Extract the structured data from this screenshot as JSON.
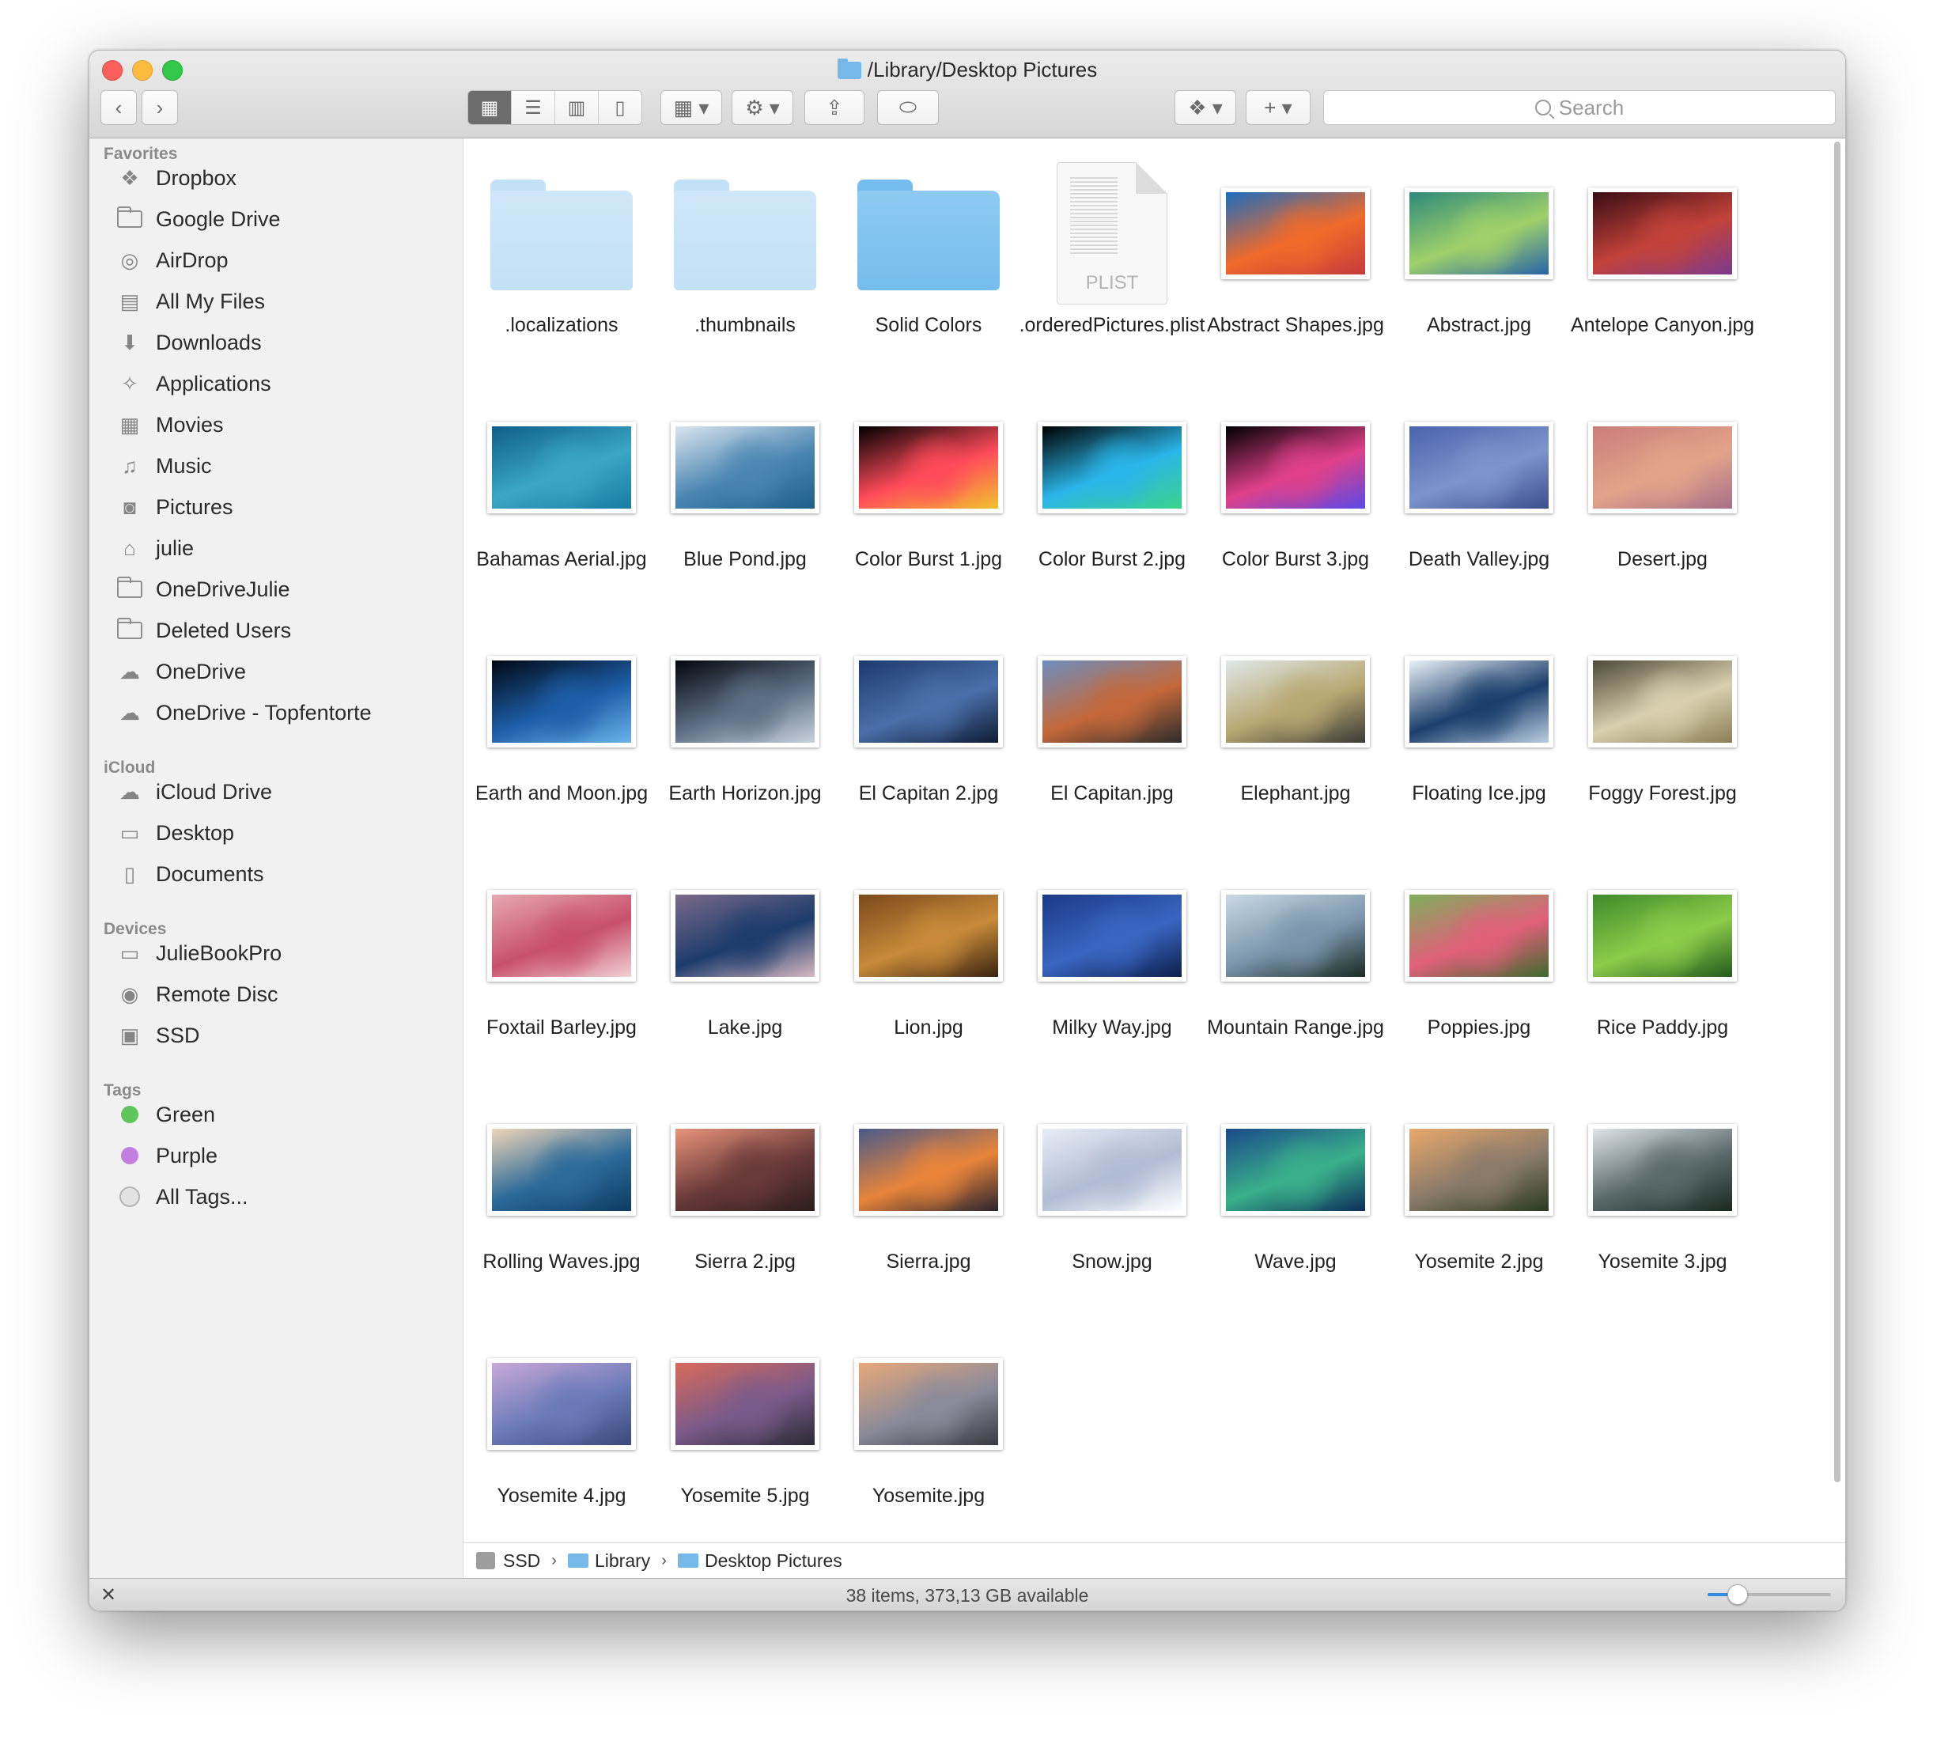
{
  "window": {
    "title": "/Library/Desktop Pictures"
  },
  "toolbar": {
    "back": "‹",
    "forward": "›",
    "search_placeholder": "Search",
    "view_modes": [
      "icon",
      "list",
      "column",
      "cover-flow"
    ],
    "selected_view": "icon"
  },
  "sidebar": {
    "favorites_label": "Favorites",
    "favorites": [
      {
        "label": "Dropbox",
        "icon": "dropbox-icon"
      },
      {
        "label": "Google Drive",
        "icon": "folder-icon"
      },
      {
        "label": "AirDrop",
        "icon": "airdrop-icon"
      },
      {
        "label": "All My Files",
        "icon": "all-files-icon"
      },
      {
        "label": "Downloads",
        "icon": "download-icon"
      },
      {
        "label": "Applications",
        "icon": "applications-icon"
      },
      {
        "label": "Movies",
        "icon": "movies-icon"
      },
      {
        "label": "Music",
        "icon": "music-icon"
      },
      {
        "label": "Pictures",
        "icon": "camera-icon"
      },
      {
        "label": "julie",
        "icon": "home-icon"
      },
      {
        "label": "OneDriveJulie",
        "icon": "folder-icon"
      },
      {
        "label": "Deleted Users",
        "icon": "folder-icon"
      },
      {
        "label": "OneDrive",
        "icon": "cloud-icon"
      },
      {
        "label": "OneDrive - Topfentorte",
        "icon": "cloud-icon"
      }
    ],
    "icloud_label": "iCloud",
    "icloud": [
      {
        "label": "iCloud Drive",
        "icon": "cloud-icon"
      },
      {
        "label": "Desktop",
        "icon": "desktop-icon"
      },
      {
        "label": "Documents",
        "icon": "document-icon"
      }
    ],
    "devices_label": "Devices",
    "devices": [
      {
        "label": "JulieBookPro",
        "icon": "laptop-icon"
      },
      {
        "label": "Remote Disc",
        "icon": "disc-icon"
      },
      {
        "label": "SSD",
        "icon": "drive-icon"
      }
    ],
    "tags_label": "Tags",
    "tags": [
      {
        "label": "Green",
        "color": "#5dc55b"
      },
      {
        "label": "Purple",
        "color": "#c27fe0"
      },
      {
        "label": "All Tags...",
        "color": "#e2e2e2"
      }
    ]
  },
  "files": [
    {
      "name": ".localizations",
      "kind": "folder",
      "colors": [
        "#cfe7f8",
        "#c2e0f6"
      ]
    },
    {
      "name": ".thumbnails",
      "kind": "folder",
      "colors": [
        "#cfe7f8",
        "#c2e0f6"
      ]
    },
    {
      "name": "Solid Colors",
      "kind": "folder",
      "colors": [
        "#8dcaf1",
        "#74bdee"
      ]
    },
    {
      "name": ".orderedPictures.plist",
      "kind": "plist",
      "ext": "PLIST"
    },
    {
      "name": "Abstract Shapes.jpg",
      "kind": "image",
      "colors": [
        "#1b6dbf",
        "#f06a2a",
        "#c63b3b"
      ]
    },
    {
      "name": "Abstract.jpg",
      "kind": "image",
      "colors": [
        "#2e8a7a",
        "#9fd06a",
        "#2864a8"
      ]
    },
    {
      "name": "Antelope Canyon.jpg",
      "kind": "image",
      "colors": [
        "#3a0d14",
        "#c3423a",
        "#7d3a8e"
      ]
    },
    {
      "name": "Bahamas Aerial.jpg",
      "kind": "image",
      "colors": [
        "#0f5f8a",
        "#3aa6c6",
        "#1a7ca3"
      ]
    },
    {
      "name": "Blue Pond.jpg",
      "kind": "image",
      "colors": [
        "#d9e4ee",
        "#4b86b2",
        "#1e5f8c"
      ]
    },
    {
      "name": "Color Burst 1.jpg",
      "kind": "image",
      "colors": [
        "#000000",
        "#ff4a5a",
        "#f2c12e"
      ]
    },
    {
      "name": "Color Burst 2.jpg",
      "kind": "image",
      "colors": [
        "#000000",
        "#2ab5e8",
        "#3ad48c"
      ]
    },
    {
      "name": "Color Burst 3.jpg",
      "kind": "image",
      "colors": [
        "#000000",
        "#e0408a",
        "#5a4ae6"
      ]
    },
    {
      "name": "Death Valley.jpg",
      "kind": "image",
      "colors": [
        "#4a64ac",
        "#7d93cc",
        "#3b4f8e"
      ]
    },
    {
      "name": "Desert.jpg",
      "kind": "image",
      "colors": [
        "#c97d7a",
        "#e3a38a",
        "#a67088"
      ]
    },
    {
      "name": "Earth and Moon.jpg",
      "kind": "image",
      "colors": [
        "#020814",
        "#1d5ea8",
        "#69b3e9"
      ]
    },
    {
      "name": "Earth Horizon.jpg",
      "kind": "image",
      "colors": [
        "#05070c",
        "#5d6f86",
        "#c8d2dc"
      ]
    },
    {
      "name": "El Capitan 2.jpg",
      "kind": "image",
      "colors": [
        "#1e3a6c",
        "#4b6faa",
        "#0f1c34"
      ]
    },
    {
      "name": "El Capitan.jpg",
      "kind": "image",
      "colors": [
        "#6d8ebf",
        "#c4683a",
        "#2c2c2c"
      ]
    },
    {
      "name": "Elephant.jpg",
      "kind": "image",
      "colors": [
        "#dfe7e8",
        "#b8a772",
        "#3a3a36"
      ]
    },
    {
      "name": "Floating Ice.jpg",
      "kind": "image",
      "colors": [
        "#e9f0f6",
        "#1c3f6c",
        "#b9cde0"
      ]
    },
    {
      "name": "Foggy Forest.jpg",
      "kind": "image",
      "colors": [
        "#4e4a38",
        "#d8cfae",
        "#8c7f58"
      ]
    },
    {
      "name": "Foxtail Barley.jpg",
      "kind": "image",
      "colors": [
        "#e6a8b0",
        "#c8506a",
        "#f1d0d4"
      ]
    },
    {
      "name": "Lake.jpg",
      "kind": "image",
      "colors": [
        "#7a6a8a",
        "#1d3c6c",
        "#d8b8c0"
      ]
    },
    {
      "name": "Lion.jpg",
      "kind": "image",
      "colors": [
        "#7a4a1c",
        "#c88a3a",
        "#3a2410"
      ]
    },
    {
      "name": "Milky Way.jpg",
      "kind": "image",
      "colors": [
        "#1b3a86",
        "#3a66c2",
        "#0d1f4d"
      ]
    },
    {
      "name": "Mountain Range.jpg",
      "kind": "image",
      "colors": [
        "#c9d8e4",
        "#7a95ac",
        "#1a2a22"
      ]
    },
    {
      "name": "Poppies.jpg",
      "kind": "image",
      "colors": [
        "#7fae5c",
        "#e0607a",
        "#3f6a2e"
      ]
    },
    {
      "name": "Rice Paddy.jpg",
      "kind": "image",
      "colors": [
        "#3f8a2a",
        "#8ccc4a",
        "#245a1c"
      ]
    },
    {
      "name": "Rolling Waves.jpg",
      "kind": "image",
      "colors": [
        "#f0d6b8",
        "#2c6a9a",
        "#0e3c62"
      ]
    },
    {
      "name": "Sierra 2.jpg",
      "kind": "image",
      "colors": [
        "#e8937a",
        "#6a3a3a",
        "#2c1e1c"
      ]
    },
    {
      "name": "Sierra.jpg",
      "kind": "image",
      "colors": [
        "#4a5a8a",
        "#e8843a",
        "#2a2430"
      ]
    },
    {
      "name": "Snow.jpg",
      "kind": "image",
      "colors": [
        "#e8ecf4",
        "#b0bcd4",
        "#ffffff"
      ]
    },
    {
      "name": "Wave.jpg",
      "kind": "image",
      "colors": [
        "#1a4a8a",
        "#3ab08a",
        "#0d2e5c"
      ]
    },
    {
      "name": "Yosemite 2.jpg",
      "kind": "image",
      "colors": [
        "#e8a86a",
        "#8a7a6a",
        "#2a3a22"
      ]
    },
    {
      "name": "Yosemite 3.jpg",
      "kind": "image",
      "colors": [
        "#dfe4e8",
        "#5a6a6a",
        "#1a2a22"
      ]
    },
    {
      "name": "Yosemite 4.jpg",
      "kind": "image",
      "colors": [
        "#c8a8d8",
        "#6a7ab8",
        "#3a4a7a"
      ]
    },
    {
      "name": "Yosemite 5.jpg",
      "kind": "image",
      "colors": [
        "#d86a5a",
        "#7a5a8a",
        "#2a2a34"
      ]
    },
    {
      "name": "Yosemite.jpg",
      "kind": "image",
      "colors": [
        "#e8a87a",
        "#8a8a9a",
        "#3a3a42"
      ]
    }
  ],
  "pathbar": {
    "items": [
      "SSD",
      "Library",
      "Desktop Pictures"
    ]
  },
  "status": {
    "text": "38 items, 373,13 GB available",
    "icon_size_fraction": 0.24
  }
}
